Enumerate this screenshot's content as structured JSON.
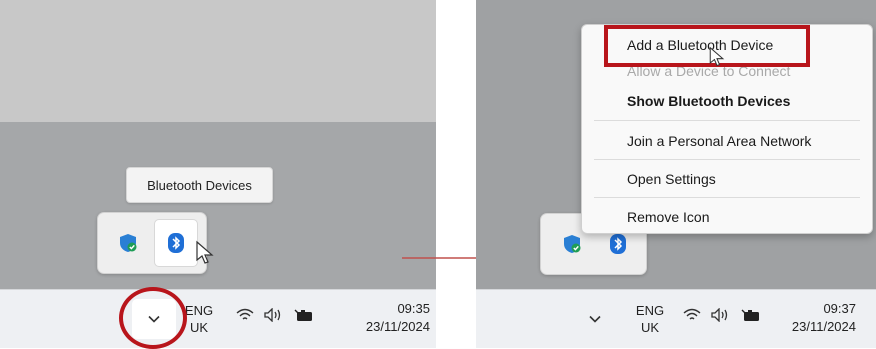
{
  "left": {
    "tooltip": "Bluetooth Devices",
    "tray_icons": [
      "shield-icon",
      "bluetooth-icon"
    ],
    "taskbar": {
      "lang_top": "ENG",
      "lang_bottom": "UK",
      "time": "09:35",
      "date": "23/11/2024"
    }
  },
  "right": {
    "menu_items": [
      {
        "label": "Add a Bluetooth Device",
        "state": "highlighted"
      },
      {
        "label": "Allow a Device to Connect",
        "state": "disabled"
      },
      {
        "label": "Show Bluetooth Devices",
        "state": "default"
      },
      {
        "label": "Join a Personal Area Network",
        "state": "normal"
      },
      {
        "label": "Open Settings",
        "state": "normal"
      },
      {
        "label": "Remove Icon",
        "state": "normal"
      }
    ],
    "tray_icons": [
      "shield-icon",
      "bluetooth-icon"
    ],
    "taskbar": {
      "lang_top": "ENG",
      "lang_bottom": "UK",
      "time": "09:37",
      "date": "23/11/2024"
    }
  },
  "colors": {
    "annotation": "#b8151b",
    "bluetooth": "#1f6fd6",
    "shield": "#2a7fd4",
    "shield_check": "#1f9d55"
  }
}
